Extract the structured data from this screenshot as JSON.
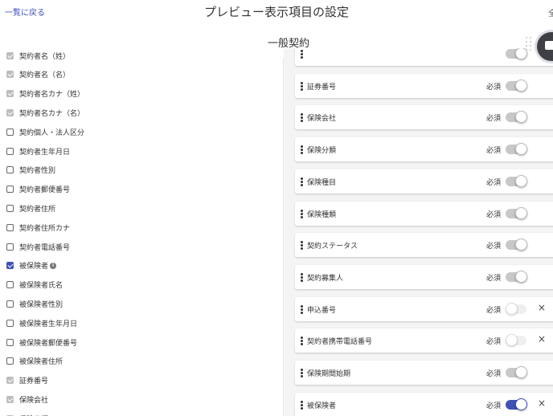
{
  "header": {
    "back_link": "一覧に戻る",
    "title": "プレビュー表示項目の設定",
    "right_partial": "全"
  },
  "section": {
    "title": "一般契約"
  },
  "checklist": [
    {
      "label": "契約者名（姓）",
      "state": "disabled"
    },
    {
      "label": "契約者名（名）",
      "state": "disabled"
    },
    {
      "label": "契約者名カナ（姓）",
      "state": "disabled"
    },
    {
      "label": "契約者名カナ（名）",
      "state": "disabled"
    },
    {
      "label": "契約個人・法人区分",
      "state": "unchecked"
    },
    {
      "label": "契約者生年月日",
      "state": "unchecked"
    },
    {
      "label": "契約者性別",
      "state": "unchecked"
    },
    {
      "label": "契約者郵便番号",
      "state": "unchecked"
    },
    {
      "label": "契約者住所",
      "state": "unchecked"
    },
    {
      "label": "契約者住所カナ",
      "state": "unchecked"
    },
    {
      "label": "契約者電話番号",
      "state": "unchecked"
    },
    {
      "label": "被保険者",
      "state": "checked",
      "info": true
    },
    {
      "label": "被保険者氏名",
      "state": "unchecked"
    },
    {
      "label": "被保険者性別",
      "state": "unchecked"
    },
    {
      "label": "被保険者生年月日",
      "state": "unchecked"
    },
    {
      "label": "被保険者郵便番号",
      "state": "unchecked"
    },
    {
      "label": "被保険者住所",
      "state": "unchecked"
    },
    {
      "label": "証券番号",
      "state": "disabled"
    },
    {
      "label": "保険会社",
      "state": "disabled"
    },
    {
      "label": "保険分類",
      "state": "disabled"
    }
  ],
  "selected_items": [
    {
      "label": "",
      "required": "",
      "toggle": "on-disabled",
      "removable": false
    },
    {
      "label": "証券番号",
      "required": "必須",
      "toggle": "on-disabled",
      "removable": false
    },
    {
      "label": "保険会社",
      "required": "必須",
      "toggle": "on-disabled",
      "removable": false
    },
    {
      "label": "保険分類",
      "required": "必須",
      "toggle": "on-disabled",
      "removable": false
    },
    {
      "label": "保険種目",
      "required": "必須",
      "toggle": "on-disabled",
      "removable": false
    },
    {
      "label": "保険種類",
      "required": "必須",
      "toggle": "on-disabled",
      "removable": false
    },
    {
      "label": "契約ステータス",
      "required": "必須",
      "toggle": "on-disabled",
      "removable": false
    },
    {
      "label": "契約募集人",
      "required": "必須",
      "toggle": "on-disabled",
      "removable": false
    },
    {
      "label": "申込番号",
      "required": "必須",
      "toggle": "off",
      "removable": true
    },
    {
      "label": "契約者携帯電話番号",
      "required": "必須",
      "toggle": "off",
      "removable": true
    },
    {
      "label": "保険期間始期",
      "required": "必須",
      "toggle": "on-disabled",
      "removable": false
    },
    {
      "label": "被保険者",
      "required": "必須",
      "toggle": "on-active",
      "removable": true
    }
  ],
  "icons": {
    "info": "i",
    "remove": "×"
  },
  "colors": {
    "accent": "#3f51b5",
    "disabled": "#bdbdbd"
  }
}
